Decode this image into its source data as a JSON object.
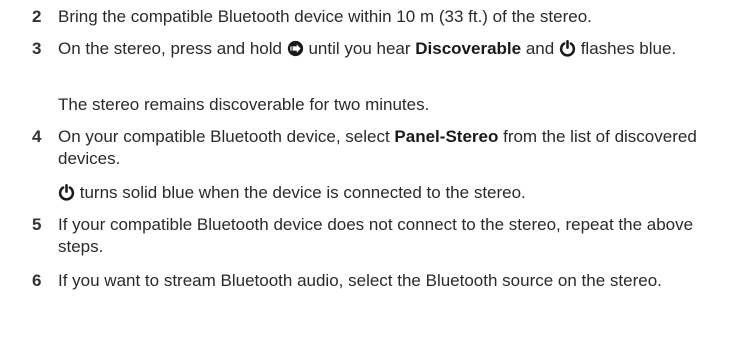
{
  "steps": [
    {
      "number": "2",
      "text": "Bring the compatible Bluetooth device within 10 m (33 ft.) of the stereo."
    },
    {
      "number": "3",
      "text_a": "On the stereo, press and hold",
      "text_b": "until you hear",
      "bold": "Discoverable",
      "text_c": "and",
      "text_d": "flashes blue.",
      "note": "The stereo remains discoverable for two minutes."
    },
    {
      "number": "4",
      "text_a": "On your compatible Bluetooth device, select",
      "bold": "Panel-Stereo",
      "text_b": "from the list of discovered devices.",
      "note": "turns solid blue when the device is connected to the stereo."
    },
    {
      "number": "5",
      "text": "If your compatible Bluetooth device does not connect to the stereo, repeat the above steps."
    },
    {
      "number": "6",
      "text": "If you want to stream Bluetooth audio, select the Bluetooth source on the stereo."
    }
  ],
  "icons": {
    "source": "source-arrow-icon",
    "power": "power-icon"
  }
}
